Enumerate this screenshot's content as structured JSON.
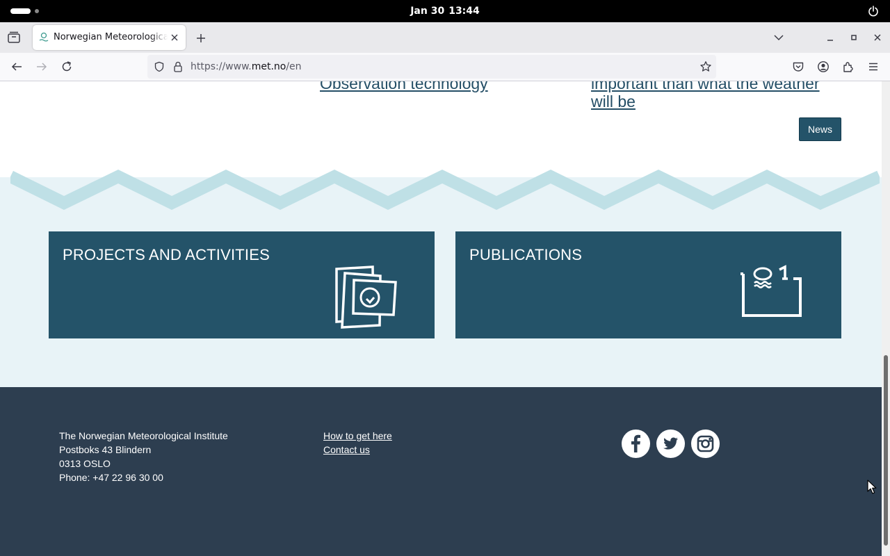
{
  "system": {
    "date": "Jan 30",
    "time": "13:44",
    "icons": [
      "activities-indicator",
      "power-icon"
    ]
  },
  "browser": {
    "tab_title": "Norwegian Meteorological Institute",
    "url_prefix": "https://www.",
    "url_host": "met.no",
    "url_path": "/en",
    "icons": [
      "tab-overview-icon",
      "close-icon",
      "plus-icon",
      "chevron-down-icon",
      "minimize-icon",
      "maximize-icon",
      "close-window-icon",
      "back-arrow-icon",
      "forward-arrow-icon",
      "reload-icon",
      "shield-icon",
      "lock-icon",
      "star-icon",
      "pocket-icon",
      "account-icon",
      "extensions-icon",
      "menu-icon"
    ]
  },
  "page": {
    "news_items": [
      {
        "line1": "Observation technology",
        "line2": ""
      },
      {
        "line1": "important than what the weather",
        "line2": "will be"
      }
    ],
    "news_button": "News",
    "cards": {
      "projects": "PROJECTS AND ACTIVITIES",
      "publications": "PUBLICATIONS"
    },
    "footer": {
      "org": "The Norwegian Meteorological Institute",
      "address": "Postboks 43 Blindern",
      "postal": "0313 OSLO",
      "phone": "Phone: +47 22 96 30 00",
      "links": [
        "How to get here",
        "Contact us"
      ],
      "social": [
        "facebook-icon",
        "twitter-icon",
        "instagram-icon"
      ]
    },
    "colors": {
      "card_bg": "#245369",
      "footer_bg": "#2d3e50",
      "band_bg": "#e8f3f7",
      "zigzag": "#bfe0e6",
      "link": "#244e66"
    }
  }
}
